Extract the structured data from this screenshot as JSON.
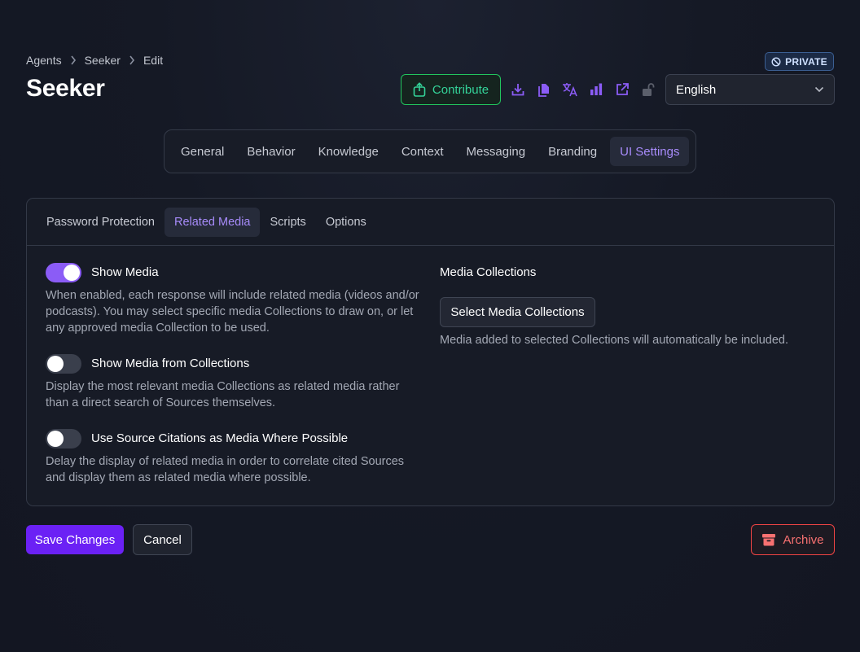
{
  "breadcrumb": {
    "items": [
      "Agents",
      "Seeker",
      "Edit"
    ]
  },
  "page": {
    "title": "Seeker"
  },
  "header": {
    "badge": "PRIVATE",
    "contribute_label": "Contribute",
    "language": "English",
    "icons": [
      "download-icon",
      "copy-icon",
      "translate-icon",
      "analytics-icon",
      "external-link-icon",
      "unlock-icon"
    ]
  },
  "main_tabs": [
    {
      "label": "General"
    },
    {
      "label": "Behavior"
    },
    {
      "label": "Knowledge"
    },
    {
      "label": "Context"
    },
    {
      "label": "Messaging"
    },
    {
      "label": "Branding"
    },
    {
      "label": "UI Settings",
      "active": true
    }
  ],
  "sub_tabs": [
    {
      "label": "Password Protection"
    },
    {
      "label": "Related Media",
      "active": true
    },
    {
      "label": "Scripts"
    },
    {
      "label": "Options"
    }
  ],
  "options": [
    {
      "label": "Show Media",
      "enabled": true,
      "description": "When enabled, each response will include related media (videos and/or podcasts). You may select specific media Collections to draw on, or let any approved media Collection to be used."
    },
    {
      "label": "Show Media from Collections",
      "enabled": false,
      "description": "Display the most relevant media Collections as related media rather than a direct search of Sources themselves."
    },
    {
      "label": "Use Source Citations as Media Where Possible",
      "enabled": false,
      "description": "Delay the display of related media in order to correlate cited Sources and display them as related media where possible."
    }
  ],
  "media_collections": {
    "title": "Media Collections",
    "button_label": "Select Media Collections",
    "help": "Media added to selected Collections will automatically be included."
  },
  "footer": {
    "save_label": "Save Changes",
    "cancel_label": "Cancel",
    "archive_label": "Archive"
  },
  "colors": {
    "accent": "#8b5cf6",
    "primary_button": "#6b21f5",
    "success": "#22c55e",
    "danger": "#ef4444",
    "background": "#151925"
  }
}
